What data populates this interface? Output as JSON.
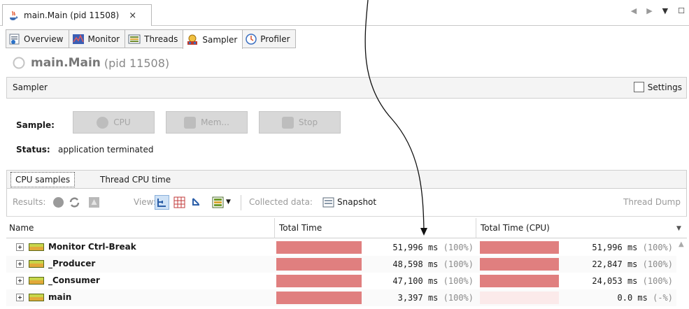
{
  "doc_tab": {
    "label": "main.Main (pid 11508)",
    "close": "×"
  },
  "subtabs": [
    {
      "label": "Overview"
    },
    {
      "label": "Monitor"
    },
    {
      "label": "Threads"
    },
    {
      "label": "Sampler"
    },
    {
      "label": "Profiler"
    }
  ],
  "title": {
    "main": "main.Main",
    "pid": "(pid 11508)"
  },
  "sampler_header": {
    "label": "Sampler",
    "settings_label": "Settings"
  },
  "sample": {
    "label": "Sample:",
    "cpu_button": "CPU",
    "mem_button": "Mem...",
    "stop_button": "Stop"
  },
  "status": {
    "label": "Status:",
    "value": "application terminated"
  },
  "cpu_tabs": {
    "samples": "CPU samples",
    "thread_cpu": "Thread CPU time"
  },
  "toolbar": {
    "results_label": "Results:",
    "view_label": "View:",
    "collected_label": "Collected data:",
    "snapshot_label": "Snapshot",
    "thread_dump_label": "Thread Dump"
  },
  "table": {
    "headers": {
      "name": "Name",
      "total_time": "Total Time",
      "total_time_cpu": "Total Time (CPU)"
    },
    "rows": [
      {
        "name": "Monitor Ctrl-Break",
        "total": "51,996 ms",
        "total_pct": "(100%)",
        "total_fill": 1.0,
        "cpu": "51,996 ms",
        "cpu_pct": "(100%)",
        "cpu_fill": 1.0
      },
      {
        "name": "_Producer",
        "total": "48,598 ms",
        "total_pct": "(100%)",
        "total_fill": 1.0,
        "cpu": "22,847 ms",
        "cpu_pct": "(100%)",
        "cpu_fill": 1.0
      },
      {
        "name": "_Consumer",
        "total": "47,100 ms",
        "total_pct": "(100%)",
        "total_fill": 1.0,
        "cpu": "24,053 ms",
        "cpu_pct": "(100%)",
        "cpu_fill": 1.0
      },
      {
        "name": "main",
        "total": "3,397 ms",
        "total_pct": "(100%)",
        "total_fill": 1.0,
        "cpu": "0.0 ms",
        "cpu_pct": "(-%)",
        "cpu_fill": 0.0
      }
    ]
  },
  "colors": {
    "bar": "#e07f7f",
    "bar_empty": "#fbeaea",
    "accent_blue": "#3b7fd6"
  }
}
